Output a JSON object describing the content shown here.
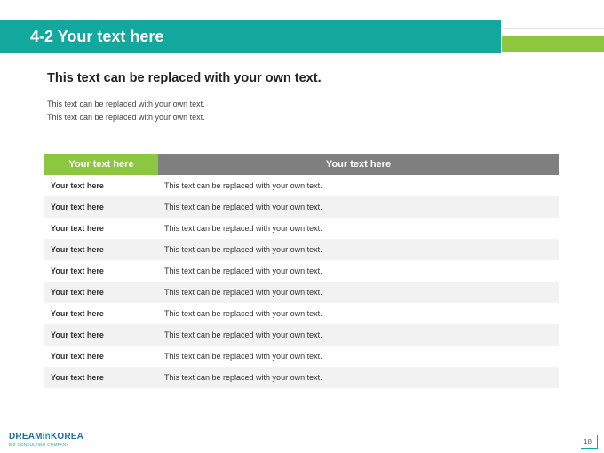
{
  "header": {
    "title": "4-2 Your text here"
  },
  "content": {
    "subtitle": "This text can be replaced with your own text.",
    "lines": [
      "This text can be replaced with your own text.",
      "This text can be replaced with your own text."
    ]
  },
  "table": {
    "headers": [
      "Your text here",
      "Your text here"
    ],
    "rows": [
      [
        "Your text here",
        "This text can be replaced with your own text."
      ],
      [
        "Your text here",
        "This text can be replaced with your own text."
      ],
      [
        "Your text here",
        "This text can be replaced with your own text."
      ],
      [
        "Your text here",
        "This text can be replaced with your own text."
      ],
      [
        "Your text here",
        "This text can be replaced with your own text."
      ],
      [
        "Your text here",
        "This text can be replaced with your own text."
      ],
      [
        "Your text here",
        "This text can be replaced with your own text."
      ],
      [
        "Your text here",
        "This text can be replaced with your own text."
      ],
      [
        "Your text here",
        "This text can be replaced with your own text."
      ],
      [
        "Your text here",
        "This text can be replaced with your own text."
      ]
    ]
  },
  "footer": {
    "logo_part1": "DREAM",
    "logo_part2": "in",
    "logo_part3": "KOREA",
    "logo_tagline": "BIZ CONSULTING COMPANY",
    "page_number": "18"
  },
  "colors": {
    "teal": "#13a89e",
    "green": "#8dc63f",
    "gray_header": "#7f7f7f",
    "row_alt": "#f2f2f2"
  }
}
